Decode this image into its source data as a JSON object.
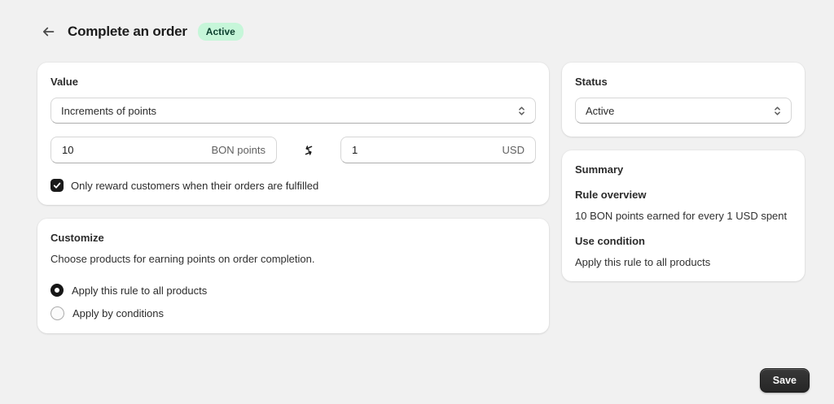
{
  "header": {
    "title": "Complete an order",
    "badge": "Active"
  },
  "value_card": {
    "title": "Value",
    "type_select": {
      "value": "Increments of points"
    },
    "points_input": {
      "value": "10",
      "suffix": "BON points"
    },
    "usd_input": {
      "value": "1",
      "suffix": "USD"
    },
    "fulfilled_checkbox": {
      "label": "Only reward customers when their orders are fulfilled",
      "checked": true
    }
  },
  "customize_card": {
    "title": "Customize",
    "description": "Choose products for earning points on order completion.",
    "options": [
      {
        "label": "Apply this rule to all products",
        "selected": true
      },
      {
        "label": "Apply by conditions",
        "selected": false
      }
    ]
  },
  "status_card": {
    "title": "Status",
    "select": {
      "value": "Active"
    }
  },
  "summary_card": {
    "title": "Summary",
    "sections": [
      {
        "heading": "Rule overview",
        "text": "10 BON points earned for every 1 USD spent"
      },
      {
        "heading": "Use condition",
        "text": "Apply this rule to all products"
      }
    ]
  },
  "footer": {
    "save_label": "Save"
  },
  "icons": {
    "back": "arrow-left",
    "select_caret": "caret-up-down",
    "swap": "swap-arrows",
    "check": "checkmark"
  },
  "colors": {
    "page_bg": "#f1f1f1",
    "card_bg": "#ffffff",
    "badge_bg": "#c6f6d9",
    "badge_text": "#0e4230",
    "save_button_bg": "#2a2a2a",
    "checkbox_bg": "#1a1a1a"
  }
}
